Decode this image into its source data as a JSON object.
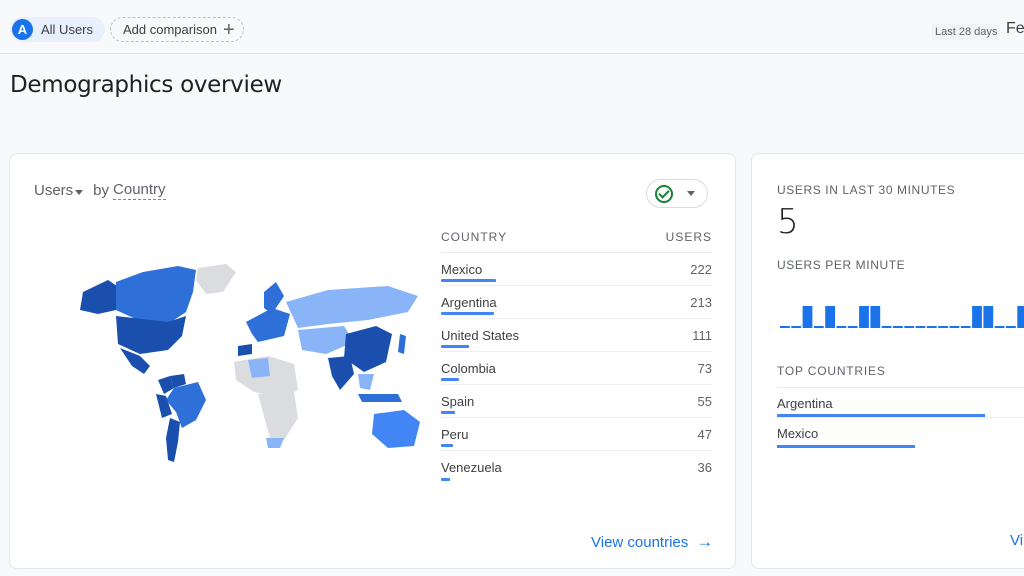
{
  "topbar": {
    "segment_avatar": "A",
    "segment_label": "All Users",
    "add_comparison_label": "Add comparison",
    "date_range_label": "Last 28 days",
    "date_text": "Feb"
  },
  "page": {
    "title": "Demographics overview"
  },
  "country_card": {
    "metric_label": "Users",
    "dimension_prefix": "by",
    "dimension_label": "Country",
    "table": {
      "columns": [
        "COUNTRY",
        "USERS"
      ],
      "rows": [
        {
          "country": "Mexico",
          "users": "222",
          "value": 222
        },
        {
          "country": "Argentina",
          "users": "213",
          "value": 213
        },
        {
          "country": "United States",
          "users": "111",
          "value": 111
        },
        {
          "country": "Colombia",
          "users": "73",
          "value": 73
        },
        {
          "country": "Spain",
          "users": "55",
          "value": 55
        },
        {
          "country": "Peru",
          "users": "47",
          "value": 47
        },
        {
          "country": "Venezuela",
          "users": "36",
          "value": 36
        }
      ]
    },
    "view_link_label": "View countries",
    "colors": {
      "dark": "#1a4fae",
      "mid": "#2f6fd8",
      "light": "#8ab4f8",
      "none": "#dadce0"
    }
  },
  "realtime_card": {
    "users_30min_label": "USERS IN LAST 30 MINUTES",
    "users_30min_value": "5",
    "per_minute_label": "USERS PER MINUTE",
    "per_minute_series": [
      0,
      0,
      1,
      0,
      1,
      0,
      0,
      1,
      1,
      0,
      0,
      0,
      0,
      0,
      0,
      0,
      0,
      1,
      1,
      0,
      0,
      1
    ],
    "top_countries_label": "TOP COUNTRIES",
    "top_countries": [
      {
        "country": "Argentina",
        "share": 0.8
      },
      {
        "country": "Mexico",
        "share": 0.53
      }
    ],
    "view_link_label": "Vi"
  },
  "accent_color": "#1a73e8"
}
